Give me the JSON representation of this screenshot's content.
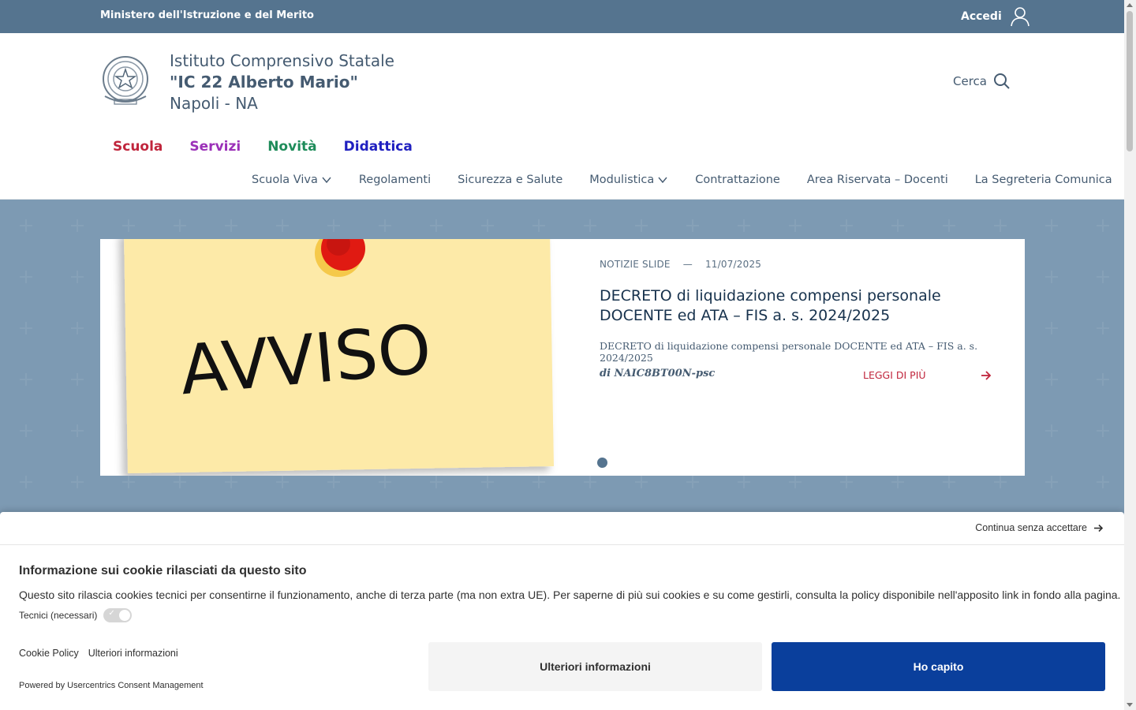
{
  "topbar": {
    "ministry": "Ministero dell'Istruzione e del Merito",
    "login_label": "Accedi"
  },
  "header": {
    "line1": "Istituto Comprensivo Statale",
    "line2": "\"IC 22 Alberto Mario\"",
    "line3": "Napoli - NA",
    "search_label": "Cerca"
  },
  "mainnav": {
    "items": [
      {
        "label": "Scuola",
        "color": "#c0253c"
      },
      {
        "label": "Servizi",
        "color": "#9b30b8"
      },
      {
        "label": "Novità",
        "color": "#1e8c5a"
      },
      {
        "label": "Didattica",
        "color": "#2020c0"
      }
    ]
  },
  "subnav": {
    "items": [
      {
        "label": "Scuola Viva",
        "dropdown": true
      },
      {
        "label": "Regolamenti",
        "dropdown": false
      },
      {
        "label": "Sicurezza e Salute",
        "dropdown": false
      },
      {
        "label": "Modulistica",
        "dropdown": true
      },
      {
        "label": "Contrattazione",
        "dropdown": false
      },
      {
        "label": "Area Riservata – Docenti",
        "dropdown": false
      },
      {
        "label": "La Segreteria Comunica",
        "dropdown": false
      }
    ]
  },
  "slide": {
    "image_text": "AVVISO",
    "category": "NOTIZIE SLIDE",
    "separator": "—",
    "date": "11/07/2025",
    "title": "DECRETO di liquidazione compensi personale DOCENTE ed ATA – FIS a. s. 2024/2025",
    "description": "DECRETO di liquidazione compensi personale DOCENTE ed ATA – FIS a. s. 2024/2025",
    "author": "di NAIC8BT00N-psc",
    "read_more": "LEGGI DI PIÙ"
  },
  "cookie": {
    "continue_label": "Continua senza accettare",
    "title": "Informazione sui cookie rilasciati da questo sito",
    "text": "Questo sito rilascia cookies tecnici per consentirne il funzionamento, anche di terza parte (ma non extra UE). Per saperne di più sui cookies e su come gestirli, consulta la policy disponibile nell'apposito link in fondo alla pagina.",
    "toggle_label": "Tecnici (necessari)",
    "link_policy": "Cookie Policy",
    "link_more": "Ulteriori informazioni",
    "powered": "Powered by Usercentrics Consent Management",
    "btn_more": "Ulteriori informazioni",
    "btn_ok": "Ho capito"
  },
  "colors": {
    "topbar": "#55748f",
    "primary_text": "#455b71",
    "accent_red": "#c0253c",
    "cookie_button": "#0a3f9c"
  }
}
